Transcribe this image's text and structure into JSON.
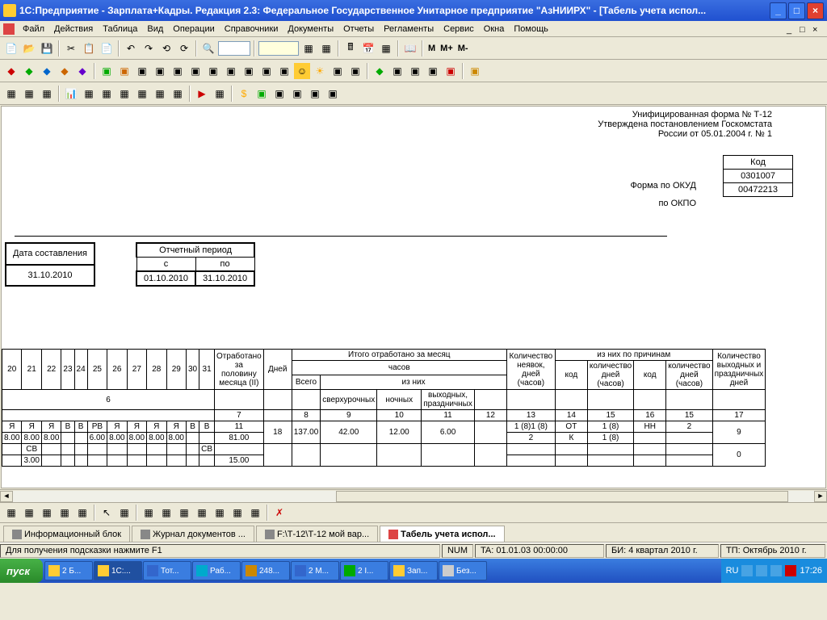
{
  "window": {
    "title": "1С:Предприятие - Зарплата+Кадры. Редакция 2.3: Федеральное Государственное Унитарное предприятие \"АзНИИРХ\" - [Табель учета испол..."
  },
  "menu": {
    "items": [
      "Файл",
      "Действия",
      "Таблица",
      "Вид",
      "Операции",
      "Справочники",
      "Документы",
      "Отчеты",
      "Регламенты",
      "Сервис",
      "Окна",
      "Помощь"
    ]
  },
  "t1": {
    "m": "М",
    "mplus": "М+",
    "mminus": "М-"
  },
  "doc": {
    "line1": "Унифицированная форма № Т-12",
    "line2": "Утверждена постановлением Госкомстата",
    "line3": "России от 05.01.2004 г. № 1",
    "kod_hdr": "Код",
    "kod1": "0301007",
    "kod2": "00472213",
    "okud": "Форма по ОКУД",
    "okpo": "по ОКПО",
    "date_comp_lbl": "Дата составления",
    "date_comp": "31.10.2010",
    "period_lbl": "Отчетный период",
    "s": "с",
    "po": "по",
    "date_from": "01.10.2010",
    "date_to": "31.10.2010"
  },
  "tbl": {
    "days": [
      "20",
      "21",
      "22",
      "23",
      "24",
      "25",
      "26",
      "27",
      "28",
      "29",
      "30",
      "31"
    ],
    "h_otrab": "Отработано за половину месяца (II)",
    "h_dney": "Дней",
    "h_itogo": "Итого отработано за месяц",
    "h_chasov": "часов",
    "h_vsego": "Всего",
    "h_iznih": "из них",
    "h_sverx": "сверхурочных",
    "h_noch": "ночных",
    "h_vyh": "выходных, праздничных",
    "h_neyav": "Количество неявок, дней (часов)",
    "h_prich": "из них по причинам",
    "h_kod": "код",
    "h_koldney": "количество дней (часов)",
    "h_kolvyh": "Количество выходных и праздничных дней",
    "cols": [
      "6",
      "7",
      "8",
      "9",
      "10",
      "11",
      "12",
      "13",
      "14",
      "15",
      "16",
      "15",
      "16",
      "17"
    ],
    "r1": {
      "marks": [
        "Я",
        "Я",
        "Я",
        "В",
        "В",
        "РВ",
        "Я",
        "Я",
        "Я",
        "Я",
        "В",
        "В"
      ],
      "c7": "11",
      "c_dney": "18",
      "c8": "137.00",
      "c9": "42.00",
      "c10": "12.00",
      "c11": "6.00",
      "c14a": "1 (8)1 (8)",
      "c15a": "ОТ",
      "c16a": "1 (8)",
      "c15b": "НН",
      "c16b": "2",
      "c17": "9"
    },
    "r2": {
      "marks": [
        "8.00",
        "8.00",
        "8.00",
        "",
        "",
        "6.00",
        "8.00",
        "8.00",
        "8.00",
        "8.00",
        "",
        ""
      ],
      "c7": "81.00",
      "c14b": "2",
      "c15a": "К",
      "c16a": "1 (8)"
    },
    "r3": {
      "cb1": "СВ",
      "cb2": "СВ"
    },
    "r4": {
      "v": "3.00",
      "c7": "15.00",
      "c17": "0"
    }
  },
  "tabs": [
    {
      "label": "Информационный блок",
      "active": false
    },
    {
      "label": "Журнал документов ...",
      "active": false
    },
    {
      "label": "F:\\Т-12\\Т-12 мой вар...",
      "active": false
    },
    {
      "label": "Табель учета испол...",
      "active": true
    }
  ],
  "status": {
    "hint": "Для получения подсказки нажмите F1",
    "num": "NUM",
    "ta": "TA: 01.01.03  00:00:00",
    "bi": "БИ: 4 квартал 2010 г.",
    "tp": "ТП: Октябрь 2010 г."
  },
  "taskbar": {
    "start": "пуск",
    "tasks": [
      "2 Б...",
      "1С:...",
      "Тот...",
      "Раб...",
      "248...",
      "2 М...",
      "2 I...",
      "Зап...",
      "Без..."
    ],
    "lang": "RU",
    "time": "17:26"
  }
}
